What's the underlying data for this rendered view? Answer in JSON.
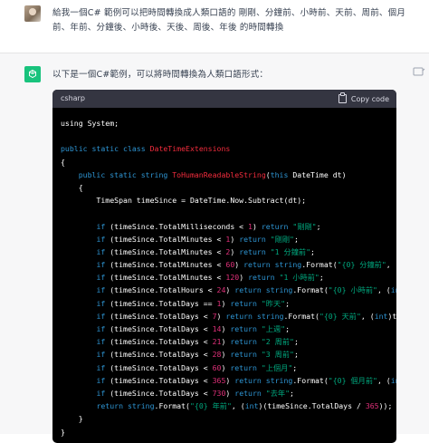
{
  "user_message": {
    "text": "給我一個C# 範例可以把時間轉換成人類口語的 剛剛、分鐘前、小時前、天前、周前、個月前、年前、分鐘後、小時後、天後、周後、年後 的時間轉換"
  },
  "assistant_message": {
    "intro": "以下是一個C#範例，可以將時間轉換為人類口語形式：",
    "code_block": {
      "language": "csharp",
      "copy_label": "Copy code",
      "lines": [
        [
          [
            "plain",
            "using System;"
          ]
        ],
        [
          [
            "plain",
            ""
          ]
        ],
        [
          [
            "kw",
            "public static class "
          ],
          [
            "ty",
            "DateTimeExtensions"
          ]
        ],
        [
          [
            "plain",
            "{"
          ]
        ],
        [
          [
            "plain",
            "    "
          ],
          [
            "kw",
            "public static string "
          ],
          [
            "fn",
            "ToHumanReadableString"
          ],
          [
            "plain",
            "("
          ],
          [
            "kw",
            "this "
          ],
          [
            "plain",
            "DateTime dt)"
          ]
        ],
        [
          [
            "plain",
            "    {"
          ]
        ],
        [
          [
            "plain",
            "        TimeSpan timeSince = DateTime.Now.Subtract(dt);"
          ]
        ],
        [
          [
            "plain",
            ""
          ]
        ],
        [
          [
            "plain",
            "        "
          ],
          [
            "kw",
            "if "
          ],
          [
            "plain",
            "(timeSince.TotalMilliseconds < "
          ],
          [
            "num",
            "1"
          ],
          [
            "plain",
            ") "
          ],
          [
            "kw",
            "return "
          ],
          [
            "str",
            "\"剛剛\""
          ],
          [
            "plain",
            ";"
          ]
        ],
        [
          [
            "plain",
            "        "
          ],
          [
            "kw",
            "if "
          ],
          [
            "plain",
            "(timeSince.TotalMinutes < "
          ],
          [
            "num",
            "1"
          ],
          [
            "plain",
            ") "
          ],
          [
            "kw",
            "return "
          ],
          [
            "str",
            "\"剛剛\""
          ],
          [
            "plain",
            ";"
          ]
        ],
        [
          [
            "plain",
            "        "
          ],
          [
            "kw",
            "if "
          ],
          [
            "plain",
            "(timeSince.TotalMinutes < "
          ],
          [
            "num",
            "2"
          ],
          [
            "plain",
            ") "
          ],
          [
            "kw",
            "return "
          ],
          [
            "str",
            "\"1 分鐘前\""
          ],
          [
            "plain",
            ";"
          ]
        ],
        [
          [
            "plain",
            "        "
          ],
          [
            "kw",
            "if "
          ],
          [
            "plain",
            "(timeSince.TotalMinutes < "
          ],
          [
            "num",
            "60"
          ],
          [
            "plain",
            ") "
          ],
          [
            "kw",
            "return string"
          ],
          [
            "plain",
            ".Format("
          ],
          [
            "str",
            "\"{0} 分鐘前\""
          ],
          [
            "plain",
            ", ("
          ],
          [
            "kw",
            "int"
          ],
          [
            "plain",
            ")tim"
          ]
        ],
        [
          [
            "plain",
            "        "
          ],
          [
            "kw",
            "if "
          ],
          [
            "plain",
            "(timeSince.TotalMinutes < "
          ],
          [
            "num",
            "120"
          ],
          [
            "plain",
            ") "
          ],
          [
            "kw",
            "return "
          ],
          [
            "str",
            "\"1 小時前\""
          ],
          [
            "plain",
            ";"
          ]
        ],
        [
          [
            "plain",
            "        "
          ],
          [
            "kw",
            "if "
          ],
          [
            "plain",
            "(timeSince.TotalHours < "
          ],
          [
            "num",
            "24"
          ],
          [
            "plain",
            ") "
          ],
          [
            "kw",
            "return string"
          ],
          [
            "plain",
            ".Format("
          ],
          [
            "str",
            "\"{0} 小時前\""
          ],
          [
            "plain",
            ", ("
          ],
          [
            "kw",
            "int"
          ],
          [
            "plain",
            ")timeS"
          ]
        ],
        [
          [
            "plain",
            "        "
          ],
          [
            "kw",
            "if "
          ],
          [
            "plain",
            "(timeSince.TotalDays == "
          ],
          [
            "num",
            "1"
          ],
          [
            "plain",
            ") "
          ],
          [
            "kw",
            "return "
          ],
          [
            "str",
            "\"昨天\""
          ],
          [
            "plain",
            ";"
          ]
        ],
        [
          [
            "plain",
            "        "
          ],
          [
            "kw",
            "if "
          ],
          [
            "plain",
            "(timeSince.TotalDays < "
          ],
          [
            "num",
            "7"
          ],
          [
            "plain",
            ") "
          ],
          [
            "kw",
            "return string"
          ],
          [
            "plain",
            ".Format("
          ],
          [
            "str",
            "\"{0} 天前\""
          ],
          [
            "plain",
            ", ("
          ],
          [
            "kw",
            "int"
          ],
          [
            "plain",
            ")timeSinc"
          ]
        ],
        [
          [
            "plain",
            "        "
          ],
          [
            "kw",
            "if "
          ],
          [
            "plain",
            "(timeSince.TotalDays < "
          ],
          [
            "num",
            "14"
          ],
          [
            "plain",
            ") "
          ],
          [
            "kw",
            "return "
          ],
          [
            "str",
            "\"上週\""
          ],
          [
            "plain",
            ";"
          ]
        ],
        [
          [
            "plain",
            "        "
          ],
          [
            "kw",
            "if "
          ],
          [
            "plain",
            "(timeSince.TotalDays < "
          ],
          [
            "num",
            "21"
          ],
          [
            "plain",
            ") "
          ],
          [
            "kw",
            "return "
          ],
          [
            "str",
            "\"2 周前\""
          ],
          [
            "plain",
            ";"
          ]
        ],
        [
          [
            "plain",
            "        "
          ],
          [
            "kw",
            "if "
          ],
          [
            "plain",
            "(timeSince.TotalDays < "
          ],
          [
            "num",
            "28"
          ],
          [
            "plain",
            ") "
          ],
          [
            "kw",
            "return "
          ],
          [
            "str",
            "\"3 周前\""
          ],
          [
            "plain",
            ";"
          ]
        ],
        [
          [
            "plain",
            "        "
          ],
          [
            "kw",
            "if "
          ],
          [
            "plain",
            "(timeSince.TotalDays < "
          ],
          [
            "num",
            "60"
          ],
          [
            "plain",
            ") "
          ],
          [
            "kw",
            "return "
          ],
          [
            "str",
            "\"上個月\""
          ],
          [
            "plain",
            ";"
          ]
        ],
        [
          [
            "plain",
            "        "
          ],
          [
            "kw",
            "if "
          ],
          [
            "plain",
            "(timeSince.TotalDays < "
          ],
          [
            "num",
            "365"
          ],
          [
            "plain",
            ") "
          ],
          [
            "kw",
            "return string"
          ],
          [
            "plain",
            ".Format("
          ],
          [
            "str",
            "\"{0} 個月前\""
          ],
          [
            "plain",
            ", ("
          ],
          [
            "kw",
            "int"
          ],
          [
            "plain",
            ")ti"
          ]
        ],
        [
          [
            "plain",
            "        "
          ],
          [
            "kw",
            "if "
          ],
          [
            "plain",
            "(timeSince.TotalDays < "
          ],
          [
            "num",
            "730"
          ],
          [
            "plain",
            ") "
          ],
          [
            "kw",
            "return "
          ],
          [
            "str",
            "\"去年\""
          ],
          [
            "plain",
            ";"
          ]
        ],
        [
          [
            "plain",
            "        "
          ],
          [
            "kw",
            "return string"
          ],
          [
            "plain",
            ".Format("
          ],
          [
            "str",
            "\"{0} 年前\""
          ],
          [
            "plain",
            ", ("
          ],
          [
            "kw",
            "int"
          ],
          [
            "plain",
            ")(timeSince.TotalDays / "
          ],
          [
            "num",
            "365"
          ],
          [
            "plain",
            "));"
          ]
        ],
        [
          [
            "plain",
            "    }"
          ]
        ],
        [
          [
            "plain",
            "}"
          ]
        ]
      ]
    }
  },
  "colors": {
    "assistant_bg": "#f7f7f8",
    "code_bg": "#000000",
    "code_header_bg": "#343541",
    "keyword": "#2e95d3",
    "type_and_method": "#f22c3d",
    "number": "#df3079",
    "string": "#00a67d",
    "brand_green": "#19c37d"
  }
}
